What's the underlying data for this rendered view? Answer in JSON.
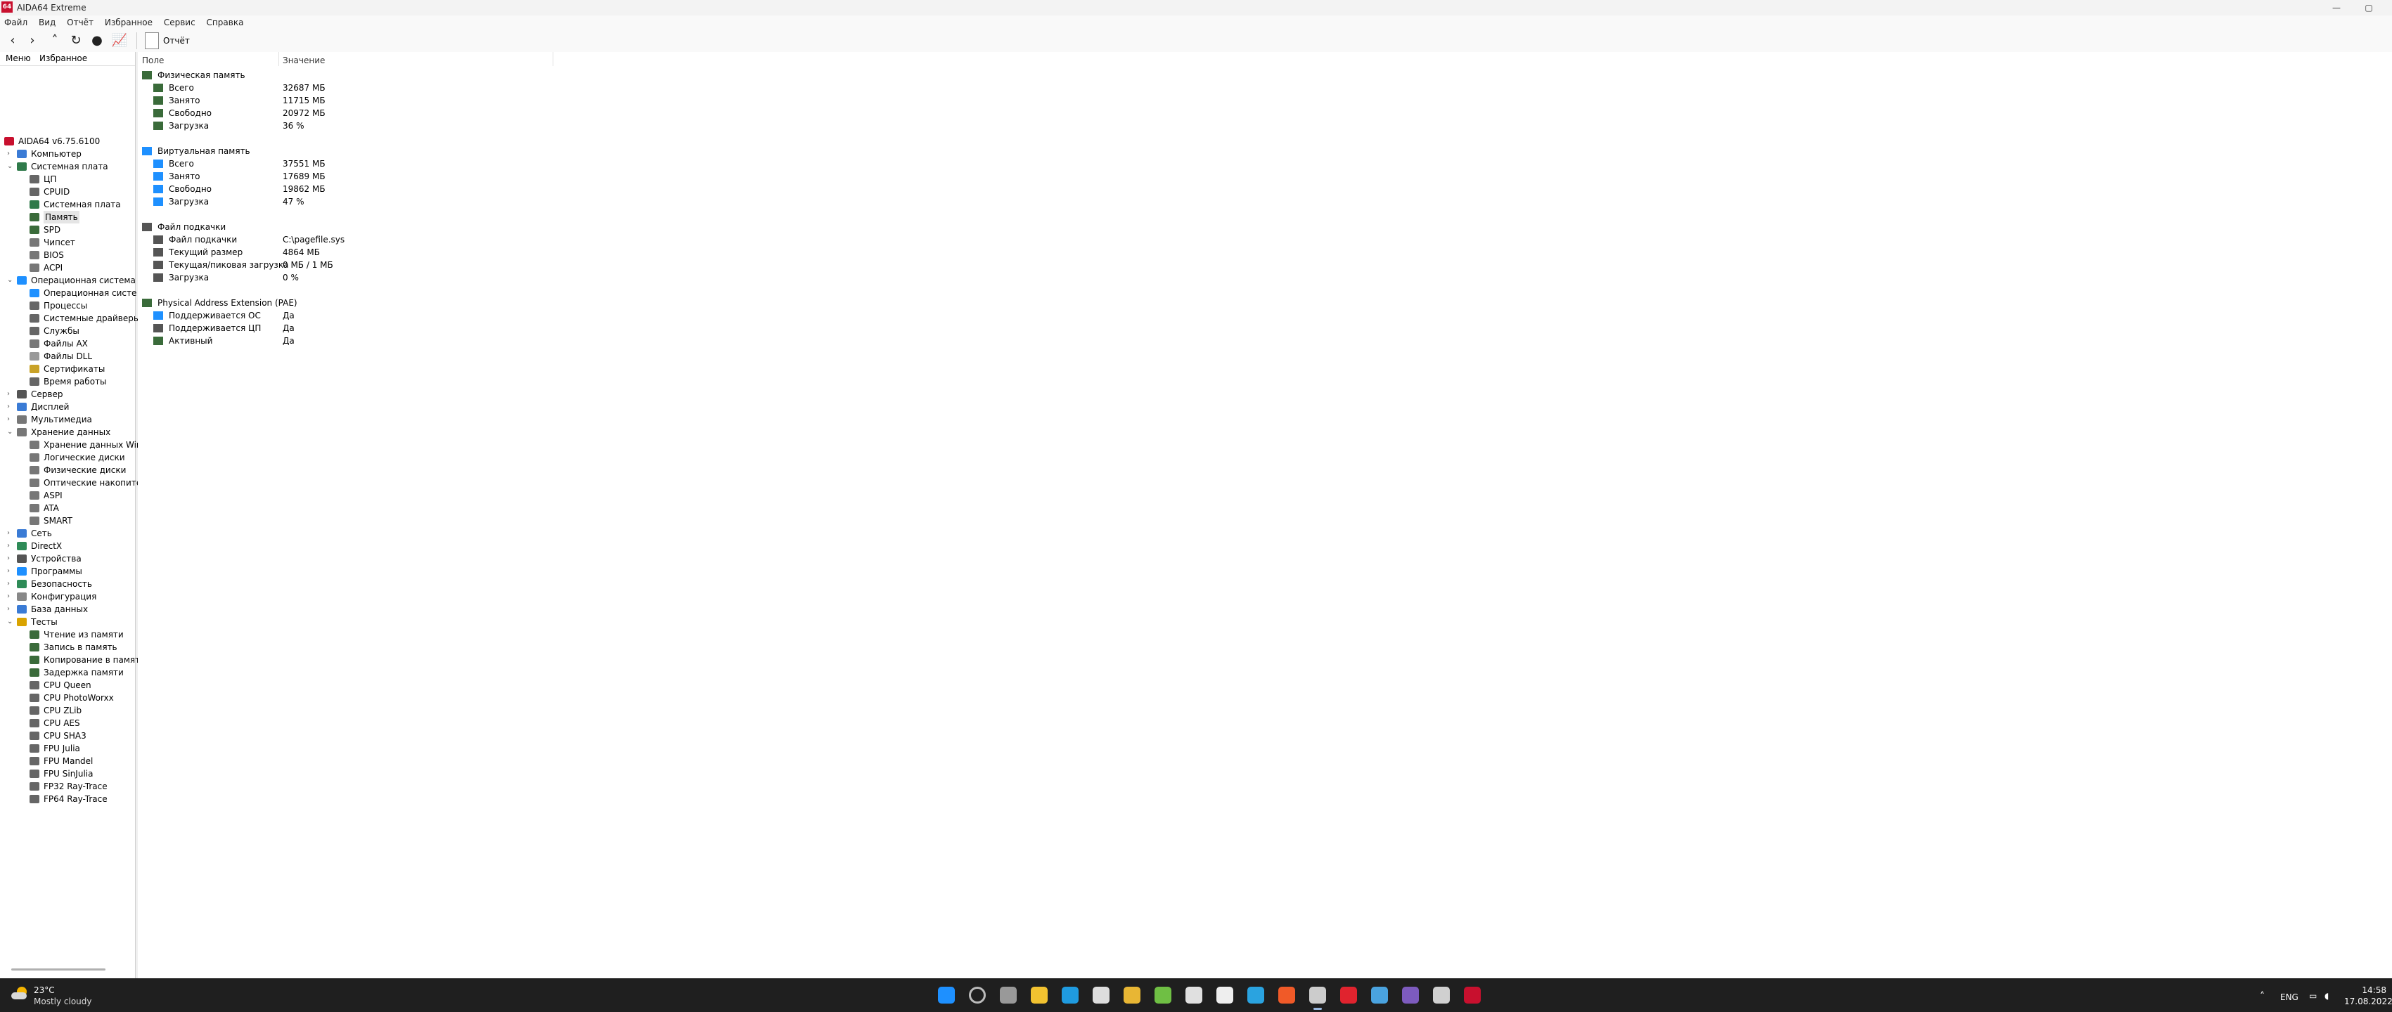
{
  "window": {
    "title": "AIDA64 Extreme",
    "app_badge": "64"
  },
  "menu": [
    "Файл",
    "Вид",
    "Отчёт",
    "Избранное",
    "Сервис",
    "Справка"
  ],
  "toolbar": {
    "report_label": "Отчёт"
  },
  "left_tabs": [
    "Меню",
    "Избранное"
  ],
  "tree": [
    {
      "label": "AIDA64 v6.75.6100",
      "level": 0,
      "icon": "aida-icon",
      "color": "#c8102e"
    },
    {
      "label": "Компьютер",
      "level": 1,
      "exp": ">",
      "icon": "computer-icon",
      "color": "#3a7bd5"
    },
    {
      "label": "Системная плата",
      "level": 1,
      "exp": "v",
      "icon": "motherboard-icon",
      "color": "#2f7a4a"
    },
    {
      "label": "ЦП",
      "level": 2,
      "icon": "cpu-icon",
      "color": "#666"
    },
    {
      "label": "CPUID",
      "level": 2,
      "icon": "cpuid-icon",
      "color": "#666"
    },
    {
      "label": "Системная плата",
      "level": 2,
      "icon": "board-icon",
      "color": "#2f7a4a"
    },
    {
      "label": "Память",
      "level": 2,
      "icon": "memory-icon",
      "color": "#3a6b3a",
      "selected": true
    },
    {
      "label": "SPD",
      "level": 2,
      "icon": "spd-icon",
      "color": "#3a6b3a"
    },
    {
      "label": "Чипсет",
      "level": 2,
      "icon": "chipset-icon",
      "color": "#777"
    },
    {
      "label": "BIOS",
      "level": 2,
      "icon": "bios-icon",
      "color": "#777"
    },
    {
      "label": "ACPI",
      "level": 2,
      "icon": "acpi-icon",
      "color": "#777"
    },
    {
      "label": "Операционная система",
      "level": 1,
      "exp": "v",
      "icon": "windows-icon",
      "color": "#1e90ff"
    },
    {
      "label": "Операционная систе",
      "level": 2,
      "icon": "windows-icon",
      "color": "#1e90ff"
    },
    {
      "label": "Процессы",
      "level": 2,
      "icon": "process-icon",
      "color": "#666"
    },
    {
      "label": "Системные драйверы",
      "level": 2,
      "icon": "driver-icon",
      "color": "#666"
    },
    {
      "label": "Службы",
      "level": 2,
      "icon": "services-icon",
      "color": "#666"
    },
    {
      "label": "Файлы AX",
      "level": 2,
      "icon": "ax-icon",
      "color": "#777"
    },
    {
      "label": "Файлы DLL",
      "level": 2,
      "icon": "dll-icon",
      "color": "#999"
    },
    {
      "label": "Сертификаты",
      "level": 2,
      "icon": "cert-icon",
      "color": "#c9a227"
    },
    {
      "label": "Время работы",
      "level": 2,
      "icon": "clock-icon",
      "color": "#666"
    },
    {
      "label": "Сервер",
      "level": 1,
      "exp": ">",
      "icon": "server-icon",
      "color": "#555"
    },
    {
      "label": "Дисплей",
      "level": 1,
      "exp": ">",
      "icon": "display-icon",
      "color": "#3a7bd5"
    },
    {
      "label": "Мультимедиа",
      "level": 1,
      "exp": ">",
      "icon": "multimedia-icon",
      "color": "#777"
    },
    {
      "label": "Хранение данных",
      "level": 1,
      "exp": "v",
      "icon": "storage-icon",
      "color": "#777"
    },
    {
      "label": "Хранение данных Win",
      "level": 2,
      "icon": "storage-icon",
      "color": "#777"
    },
    {
      "label": "Логические диски",
      "level": 2,
      "icon": "disk-icon",
      "color": "#777"
    },
    {
      "label": "Физические диски",
      "level": 2,
      "icon": "disk-icon",
      "color": "#777"
    },
    {
      "label": "Оптические накопите",
      "level": 2,
      "icon": "optical-icon",
      "color": "#777"
    },
    {
      "label": "ASPI",
      "level": 2,
      "icon": "aspi-icon",
      "color": "#777"
    },
    {
      "label": "ATA",
      "level": 2,
      "icon": "ata-icon",
      "color": "#777"
    },
    {
      "label": "SMART",
      "level": 2,
      "icon": "smart-icon",
      "color": "#777"
    },
    {
      "label": "Сеть",
      "level": 1,
      "exp": ">",
      "icon": "network-icon",
      "color": "#3a7bd5"
    },
    {
      "label": "DirectX",
      "level": 1,
      "exp": ">",
      "icon": "directx-icon",
      "color": "#2e8b57"
    },
    {
      "label": "Устройства",
      "level": 1,
      "exp": ">",
      "icon": "devices-icon",
      "color": "#555"
    },
    {
      "label": "Программы",
      "level": 1,
      "exp": ">",
      "icon": "programs-icon",
      "color": "#1e90ff"
    },
    {
      "label": "Безопасность",
      "level": 1,
      "exp": ">",
      "icon": "security-icon",
      "color": "#2e8b57"
    },
    {
      "label": "Конфигурация",
      "level": 1,
      "exp": ">",
      "icon": "config-icon",
      "color": "#888"
    },
    {
      "label": "База данных",
      "level": 1,
      "exp": ">",
      "icon": "database-icon",
      "color": "#3a7bd5"
    },
    {
      "label": "Тесты",
      "level": 1,
      "exp": "v",
      "icon": "tests-icon",
      "color": "#d9a300"
    },
    {
      "label": "Чтение из памяти",
      "level": 2,
      "icon": "memory-icon",
      "color": "#3a6b3a"
    },
    {
      "label": "Запись в память",
      "level": 2,
      "icon": "memory-icon",
      "color": "#3a6b3a"
    },
    {
      "label": "Копирование в памяти",
      "level": 2,
      "icon": "memory-icon",
      "color": "#3a6b3a"
    },
    {
      "label": "Задержка памяти",
      "level": 2,
      "icon": "memory-icon",
      "color": "#3a6b3a"
    },
    {
      "label": "CPU Queen",
      "level": 2,
      "icon": "benchmark-icon",
      "color": "#666"
    },
    {
      "label": "CPU PhotoWorxx",
      "level": 2,
      "icon": "benchmark-icon",
      "color": "#666"
    },
    {
      "label": "CPU ZLib",
      "level": 2,
      "icon": "benchmark-icon",
      "color": "#666"
    },
    {
      "label": "CPU AES",
      "level": 2,
      "icon": "benchmark-icon",
      "color": "#666"
    },
    {
      "label": "CPU SHA3",
      "level": 2,
      "icon": "benchmark-icon",
      "color": "#666"
    },
    {
      "label": "FPU Julia",
      "level": 2,
      "icon": "benchmark-icon",
      "color": "#666"
    },
    {
      "label": "FPU Mandel",
      "level": 2,
      "icon": "benchmark-icon",
      "color": "#666"
    },
    {
      "label": "FPU SinJulia",
      "level": 2,
      "icon": "benchmark-icon",
      "color": "#666"
    },
    {
      "label": "FP32 Ray-Trace",
      "level": 2,
      "icon": "benchmark-icon",
      "color": "#666"
    },
    {
      "label": "FP64 Ray-Trace",
      "level": 2,
      "icon": "benchmark-icon",
      "color": "#666"
    }
  ],
  "columns": {
    "field": "Поле",
    "value": "Значение"
  },
  "rows": [
    {
      "type": "group",
      "label": "Физическая память",
      "icon": "memory-icon",
      "color": "#3a6b3a"
    },
    {
      "type": "item",
      "label": "Всего",
      "value": "32687 МБ",
      "icon": "memory-icon",
      "color": "#3a6b3a"
    },
    {
      "type": "item",
      "label": "Занято",
      "value": "11715 МБ",
      "icon": "memory-icon",
      "color": "#3a6b3a"
    },
    {
      "type": "item",
      "label": "Свободно",
      "value": "20972 МБ",
      "icon": "memory-icon",
      "color": "#3a6b3a"
    },
    {
      "type": "item",
      "label": "Загрузка",
      "value": "36 %",
      "icon": "memory-icon",
      "color": "#3a6b3a"
    },
    {
      "type": "spacer"
    },
    {
      "type": "group",
      "label": "Виртуальная память",
      "icon": "windows-icon",
      "color": "#1e90ff"
    },
    {
      "type": "item",
      "label": "Всего",
      "value": "37551 МБ",
      "icon": "windows-icon",
      "color": "#1e90ff"
    },
    {
      "type": "item",
      "label": "Занято",
      "value": "17689 МБ",
      "icon": "windows-icon",
      "color": "#1e90ff"
    },
    {
      "type": "item",
      "label": "Свободно",
      "value": "19862 МБ",
      "icon": "windows-icon",
      "color": "#1e90ff"
    },
    {
      "type": "item",
      "label": "Загрузка",
      "value": "47 %",
      "icon": "windows-icon",
      "color": "#1e90ff"
    },
    {
      "type": "spacer"
    },
    {
      "type": "group",
      "label": "Файл подкачки",
      "icon": "disk-icon",
      "color": "#555"
    },
    {
      "type": "item",
      "label": "Файл подкачки",
      "value": "C:\\pagefile.sys",
      "icon": "disk-icon",
      "color": "#555"
    },
    {
      "type": "item",
      "label": "Текущий размер",
      "value": "4864 МБ",
      "icon": "disk-icon",
      "color": "#555"
    },
    {
      "type": "item",
      "label": "Текущая/пиковая загрузка",
      "value": "0 МБ / 1 МБ",
      "icon": "disk-icon",
      "color": "#555"
    },
    {
      "type": "item",
      "label": "Загрузка",
      "value": "0 %",
      "icon": "disk-icon",
      "color": "#555"
    },
    {
      "type": "spacer"
    },
    {
      "type": "group",
      "label": "Physical Address Extension (PAE)",
      "icon": "memory-icon",
      "color": "#3a6b3a"
    },
    {
      "type": "item",
      "label": "Поддерживается ОС",
      "value": "Да",
      "icon": "windows-icon",
      "color": "#1e90ff"
    },
    {
      "type": "item",
      "label": "Поддерживается ЦП",
      "value": "Да",
      "icon": "cpu-icon",
      "color": "#555"
    },
    {
      "type": "item",
      "label": "Активный",
      "value": "Да",
      "icon": "memory-icon",
      "color": "#3a6b3a"
    }
  ],
  "taskbar": {
    "weather_temp": "23°C",
    "weather_desc": "Mostly cloudy",
    "lang": "ENG",
    "time": "14:58",
    "date": "17.08.2022",
    "apps": [
      {
        "name": "start-icon",
        "color": "#1e90ff"
      },
      {
        "name": "search-icon",
        "color": "#bbbbbb"
      },
      {
        "name": "task-view-icon",
        "color": "#999999"
      },
      {
        "name": "file-explorer-icon",
        "color": "#f2c230"
      },
      {
        "name": "edge-icon",
        "color": "#1f9be0"
      },
      {
        "name": "store-icon",
        "color": "#dddddd"
      },
      {
        "name": "chrome-icon",
        "color": "#e8b634"
      },
      {
        "name": "utorrent-icon",
        "color": "#6fbf44"
      },
      {
        "name": "app-icon",
        "color": "#e0e0e0"
      },
      {
        "name": "yandex-icon",
        "color": "#eeeeee"
      },
      {
        "name": "telegram-icon",
        "color": "#2aa3e0"
      },
      {
        "name": "brave-icon",
        "color": "#f05a28"
      },
      {
        "name": "aida-window-icon",
        "color": "#cccccc"
      },
      {
        "name": "opera-icon",
        "color": "#e0232e"
      },
      {
        "name": "notepad-icon",
        "color": "#4aa3df"
      },
      {
        "name": "viber-icon",
        "color": "#7d5bbe"
      },
      {
        "name": "snip-icon",
        "color": "#d0d0d0"
      },
      {
        "name": "aida64-icon",
        "color": "#c8102e"
      }
    ]
  }
}
